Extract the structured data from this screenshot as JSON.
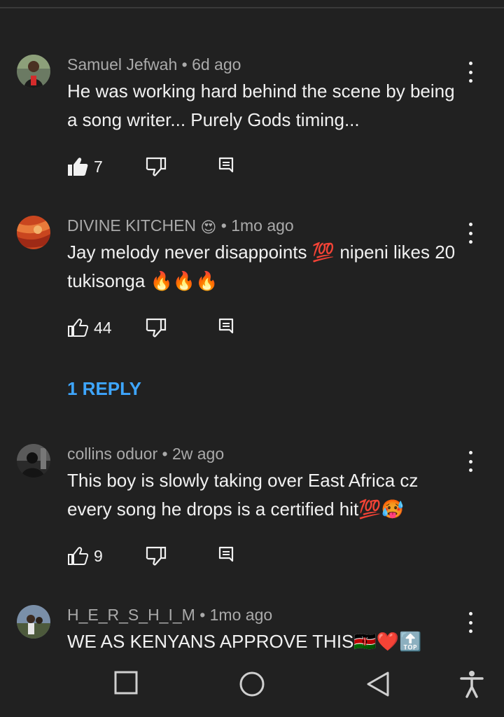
{
  "comments": [
    {
      "author": "Samuel Jefwah",
      "time": "• 6d ago",
      "text": "He was working hard behind the scene by being a song writer... Purely Gods timing...",
      "likes": "7",
      "liked": true
    },
    {
      "author": "DIVINE KITCHEN",
      "author_emoji": "😍",
      "time": "• 1mo ago",
      "text": "Jay melody never disappoints 💯 nipeni likes 20 tukisonga 🔥🔥🔥",
      "likes": "44",
      "liked": false,
      "replies_label": "1 REPLY"
    },
    {
      "author": "collins oduor",
      "time": "• 2w ago",
      "text": "This boy is slowly taking over East Africa cz every song he drops is a certified hit💯🥵",
      "likes": "9",
      "liked": false
    },
    {
      "author": "H_E_R_S_H_I_M",
      "time": "• 1mo ago",
      "text": "WE AS KENYANS APPROVE THIS🇰🇪❤️🔝",
      "liked": false
    }
  ],
  "colors": {
    "background": "#212121",
    "text": "#f1f1f1",
    "meta": "#aaaaaa",
    "link": "#3ea6ff"
  },
  "icons": {
    "like": "thumbs-up-icon",
    "dislike": "thumbs-down-icon",
    "reply": "reply-icon",
    "more": "more-vertical-icon",
    "nav": [
      "square-icon",
      "circle-icon",
      "back-triangle-icon",
      "accessibility-icon"
    ]
  }
}
